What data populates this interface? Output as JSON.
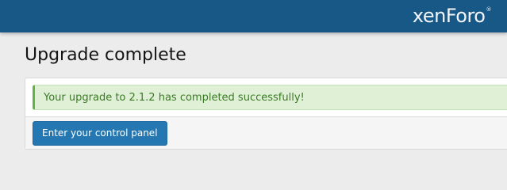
{
  "header": {
    "logo_text": "xenForo",
    "logo_mark": "®",
    "background_color": "#185886"
  },
  "page": {
    "title": "Upgrade complete"
  },
  "message": {
    "text": "Your upgrade to 2.1.2 has completed successfully!",
    "type": "success",
    "accent_color": "#63b246"
  },
  "actions": {
    "control_panel_label": "Enter your control panel",
    "button_color": "#2577b1"
  }
}
